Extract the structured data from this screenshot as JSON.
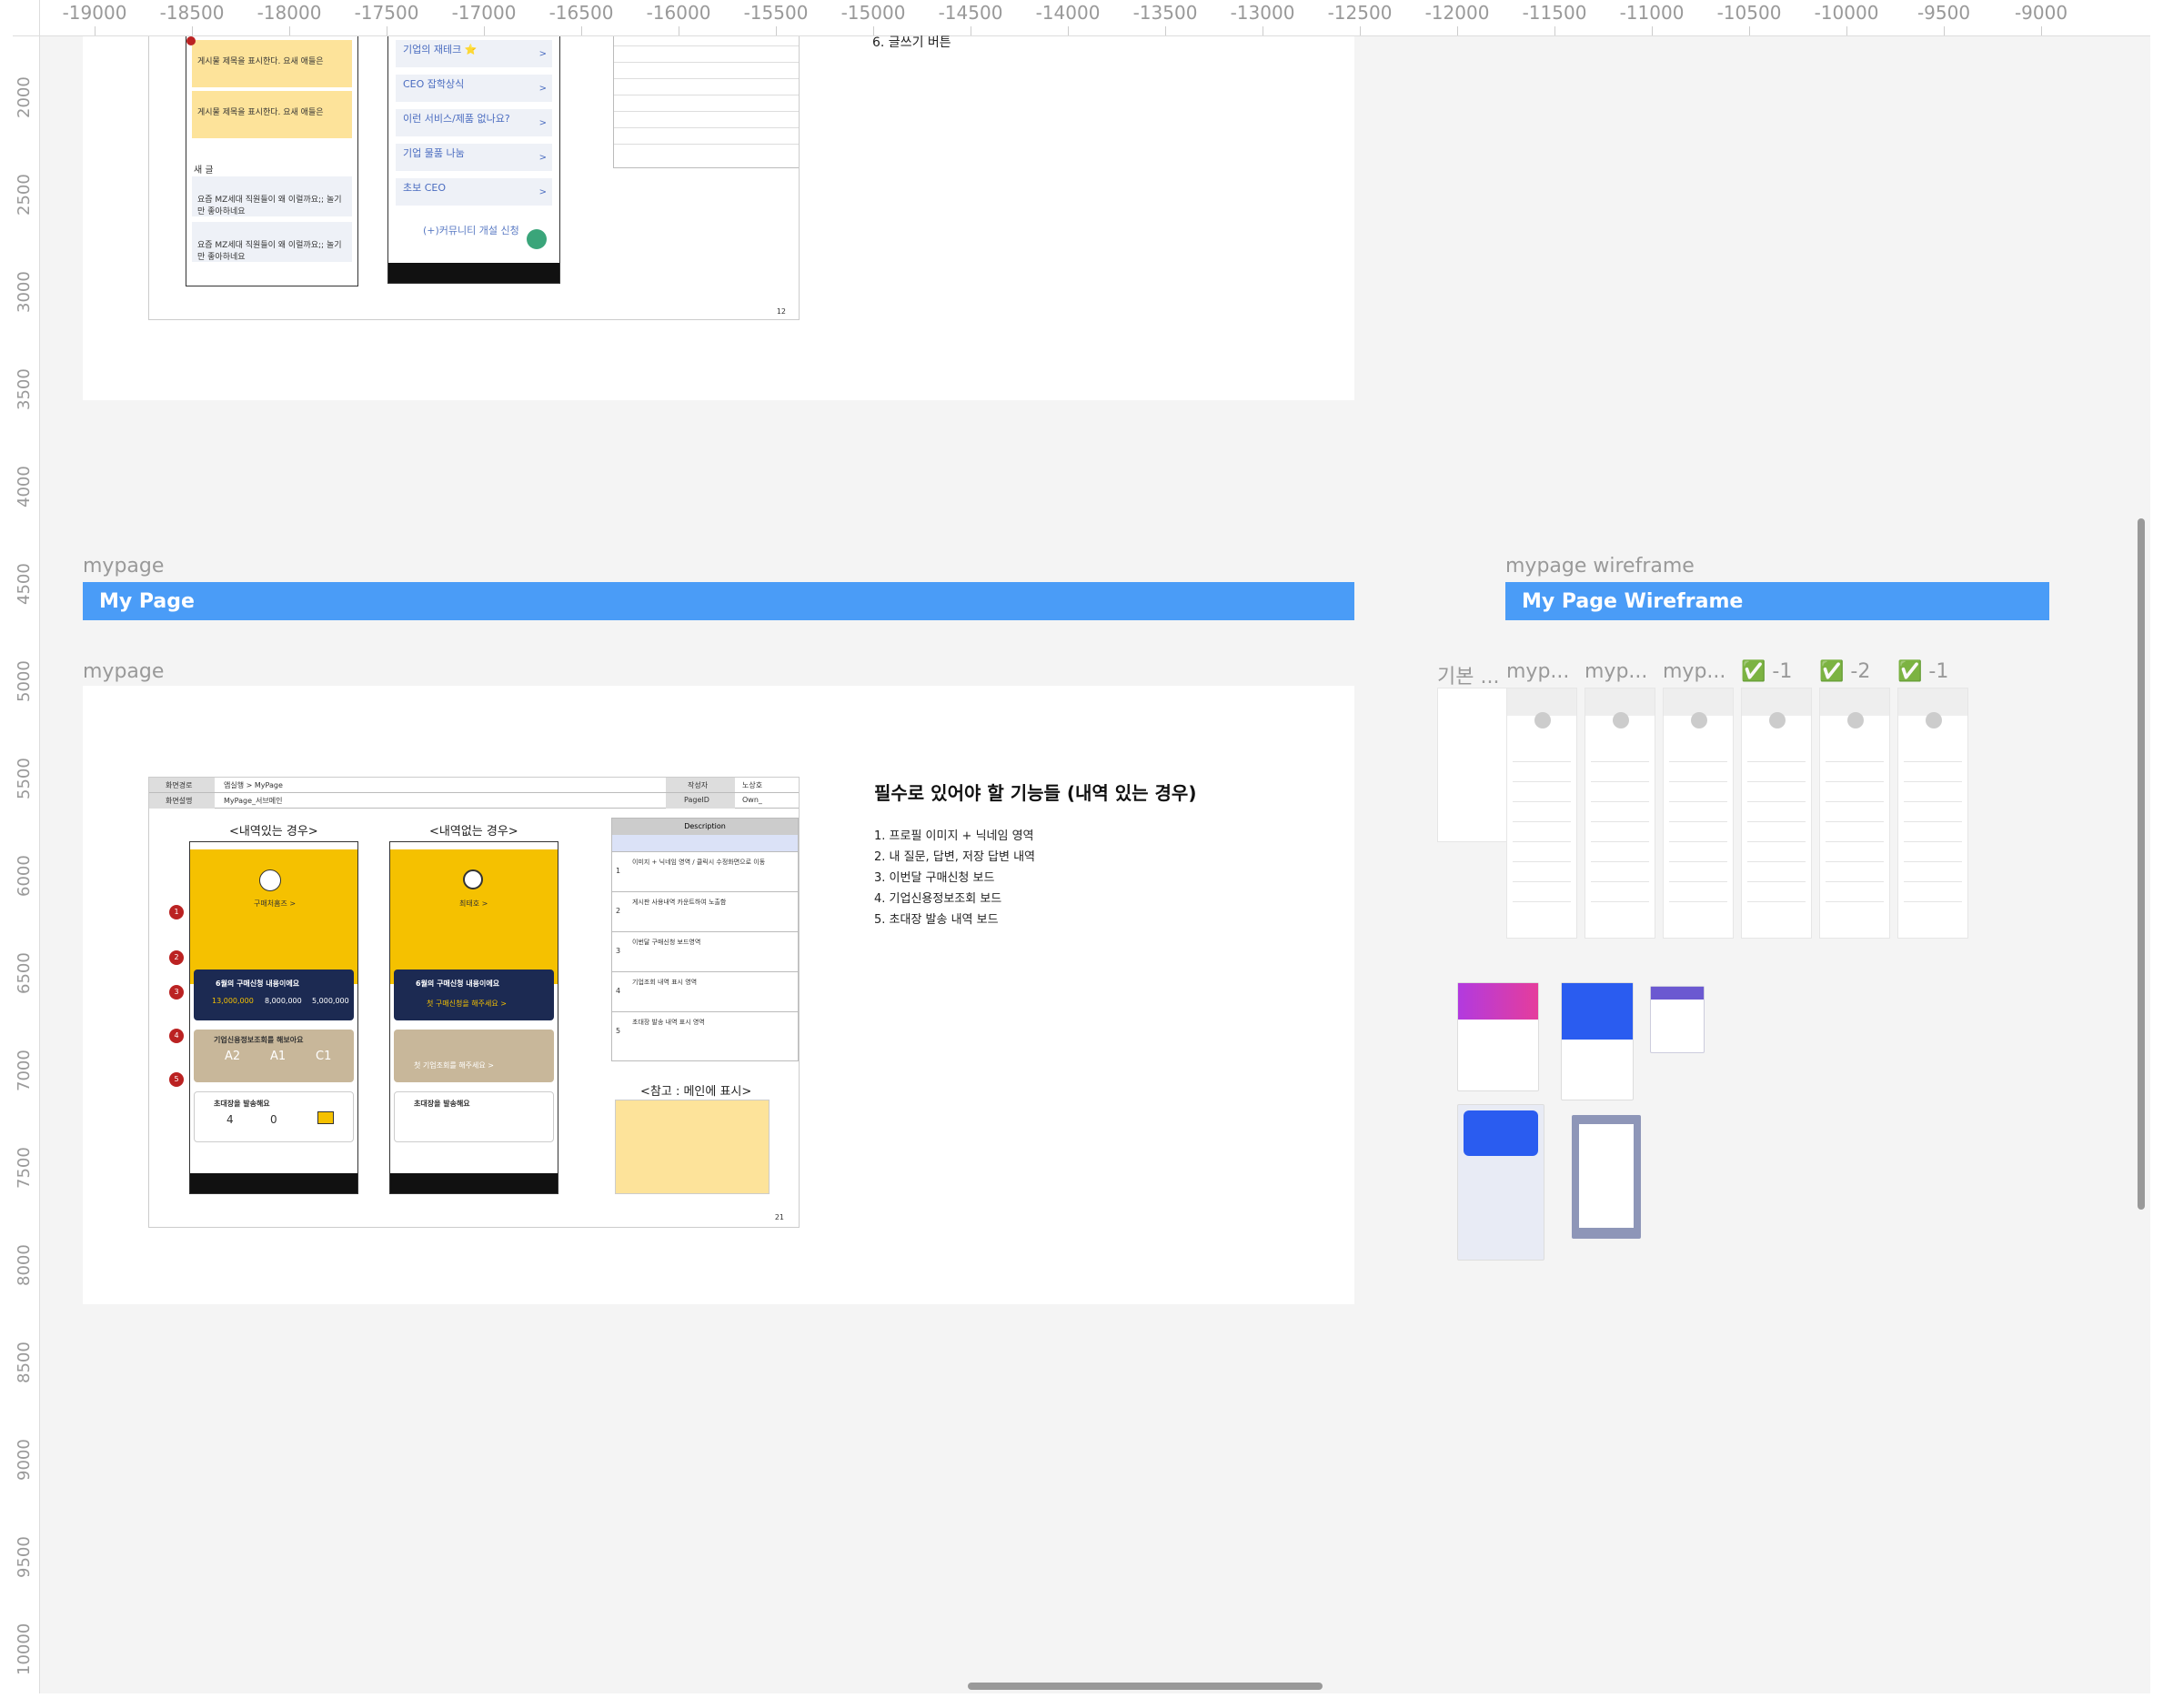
{
  "ruler": {
    "top_labels": [
      "-19000",
      "-18500",
      "-18000",
      "-17500",
      "-17000",
      "-16500",
      "-16000",
      "-15500",
      "-15000",
      "-14500",
      "-14000",
      "-13500",
      "-13000",
      "-12500",
      "-12000",
      "-11500",
      "-11000",
      "-10500",
      "-10000",
      "-9500",
      "-9000"
    ],
    "left_labels": [
      "2000",
      "2500",
      "3000",
      "3500",
      "4000",
      "4500",
      "5000",
      "5500",
      "6000",
      "6500",
      "7000",
      "7500",
      "8000",
      "8500",
      "9000",
      "9500",
      "10000"
    ]
  },
  "frames": {
    "mypage_label": "mypage",
    "mypage_title": "My Page",
    "mypage_frame_label": "mypage",
    "wire_label": "mypage wireframe",
    "wire_title": "My Page Wireframe"
  },
  "top_slide": {
    "items": [
      "기업의 재테크 ⭐",
      "CEO 잡학상식",
      "이런 서비스/제품 없나요?",
      "기업 물품 나눔",
      "초보 CEO"
    ],
    "open_btn": "(+)커뮤니티 개설 신청",
    "new_posts": "새 글",
    "page_no": "12",
    "note6": "6. 글쓰기 버튼",
    "post_title": "게시물 제목을 표시한다. 요새 애들은",
    "mz_post": "요즘 MZ세대 직원들이 왜 이럴까요;; 놀기만 좋아하네요"
  },
  "slide": {
    "hdr_route_label": "화면경로",
    "hdr_route": "앱실행 > MyPage",
    "hdr_desc_label": "화면설명",
    "hdr_desc": "MyPage_서브메인",
    "author_label": "작성자",
    "author": "노상호",
    "pageid_label": "PageID",
    "pageid": "Own_",
    "col1_title": "<내역있는 경우>",
    "col2_title": "<내역없는 경우>",
    "desc_title": "Description",
    "nick1": "구매처홈즈 >",
    "nick2": "최태호 >",
    "card_title": "6월의 구매신청 내용이에요",
    "vals": [
      "13,000,000",
      "8,000,000",
      "5,000,000"
    ],
    "empty_cta": "첫 구매신청을 해주세요 >",
    "credit_title": "기업신용정보조회를 해보아요",
    "grades": [
      "A2",
      "A1",
      "C1"
    ],
    "credit_empty": "첫 기업조회를 해주세요 >",
    "invite_title": "초대장을 발송해요",
    "invite_vals": [
      "4",
      "0"
    ],
    "ref_title": "<참고 : 메인에 표시>",
    "page_no": "21",
    "desc_rows": [
      "이미지 + 닉네임 영역 / 클릭시 수정화면으로 이동",
      "게시판 사용내역 카운트하여 노출함",
      "이번달 구매신청 보드영역",
      "기업조회 내역 표시 영역",
      "초대장 발송 내역 표시 영역"
    ]
  },
  "features": {
    "heading": "필수로 있어야 할 기능들 (내역 있는 경우)",
    "items": [
      "1. 프로필 이미지 + 닉네임 영역",
      "2. 내 질문, 답변, 저장 답변 내역",
      "3. 이번달 구매신청 보드",
      "4. 기업신용정보조회 보드",
      "5. 초대장 발송 내역 보드"
    ]
  },
  "thumbs": [
    "기본 ...",
    "myp...",
    "myp...",
    "myp...",
    "✅ -1",
    "✅ -2",
    "✅ -1"
  ]
}
